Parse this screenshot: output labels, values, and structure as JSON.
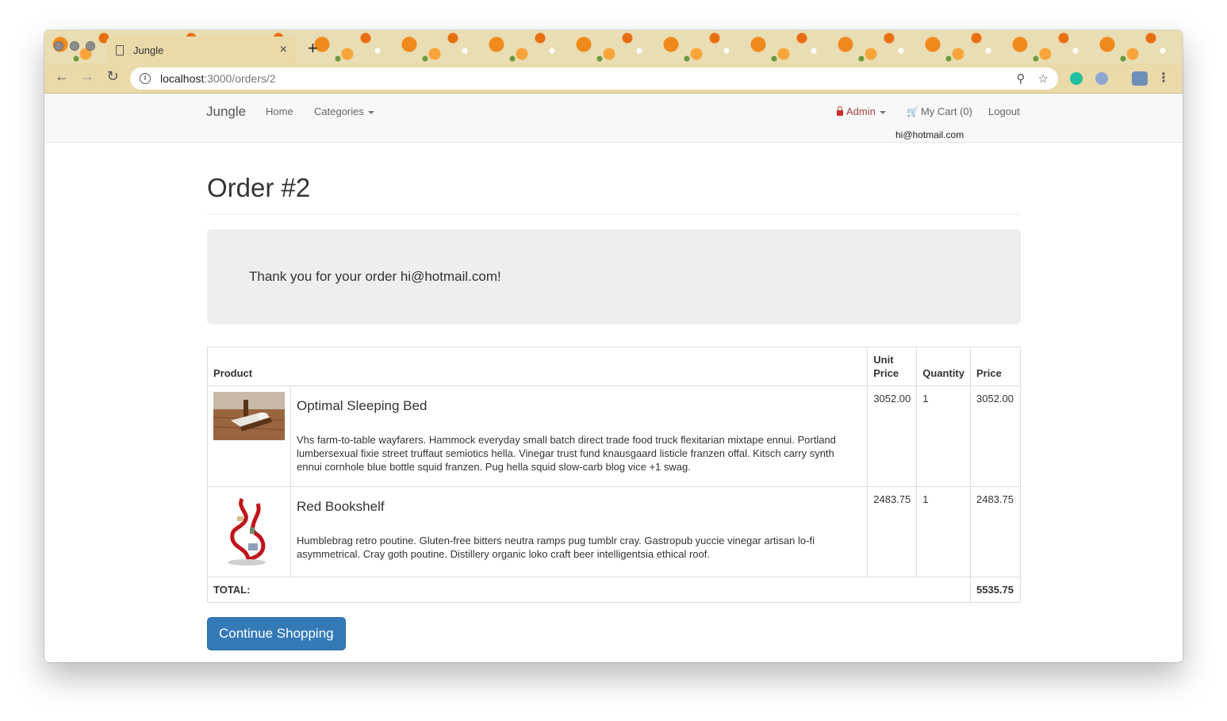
{
  "browser": {
    "tab_title": "Jungle",
    "new_tab_label": "+",
    "tab_close_label": "×",
    "url_host": "localhost",
    "url_path": ":3000/orders/2"
  },
  "navbar": {
    "brand": "Jungle",
    "home": "Home",
    "categories": "Categories",
    "admin": "Admin",
    "cart": "My Cart (0)",
    "logout": "Logout",
    "user_email": "hi@hotmail.com"
  },
  "page": {
    "title": "Order #2",
    "thank_you": "Thank you for your order hi@hotmail.com!"
  },
  "table": {
    "headers": {
      "product": "Product",
      "unit_price": "Unit Price",
      "quantity": "Quantity",
      "price": "Price"
    },
    "rows": [
      {
        "name": "Optimal Sleeping Bed",
        "description": "Vhs farm-to-table wayfarers. Hammock everyday small batch direct trade food truck flexitarian mixtape ennui. Portland lumbersexual fixie street truffaut semiotics hella. Vinegar trust fund knausgaard listicle franzen offal. Kitsch carry synth ennui cornhole blue bottle squid franzen. Pug hella squid slow-carb blog vice +1 swag.",
        "unit_price": "3052.00",
        "quantity": "1",
        "price": "3052.00"
      },
      {
        "name": "Red Bookshelf",
        "description": "Humblebrag retro poutine. Gluten-free bitters neutra ramps pug tumblr cray. Gastropub yuccie vinegar artisan lo-fi asymmetrical. Cray goth poutine. Distillery organic loko craft beer intelligentsia ethical roof.",
        "unit_price": "2483.75",
        "quantity": "1",
        "price": "2483.75"
      }
    ],
    "total_label": "TOTAL:",
    "total_value": "5535.75"
  },
  "actions": {
    "continue_shopping": "Continue Shopping"
  },
  "colors": {
    "primary": "#337ab7",
    "admin_red": "#a94442",
    "navbar_bg": "#f8f8f8",
    "jumbotron_bg": "#eeeeee"
  },
  "icons": [
    "file-icon",
    "info-icon",
    "zoom-icon",
    "star-icon",
    "lock-icon",
    "cart-icon",
    "caret-down-icon"
  ]
}
